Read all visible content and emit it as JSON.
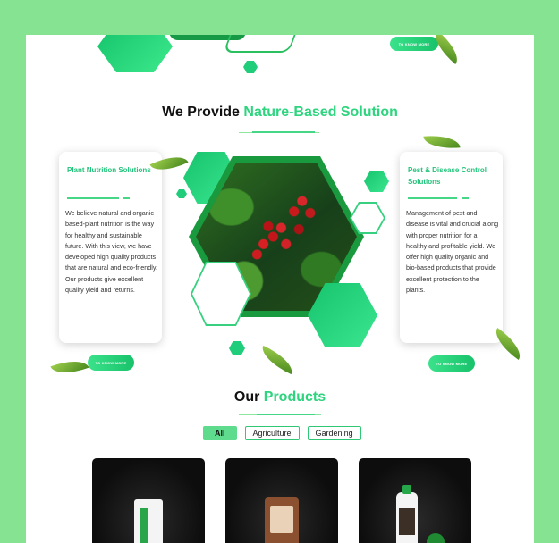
{
  "top": {
    "button_label": "TO KNOW MORE"
  },
  "provide": {
    "title_prefix": "We Provide",
    "title_accent": "Nature-Based Solution"
  },
  "cards": [
    {
      "title": "Plant Nutrition Solutions",
      "body": "We believe natural and organic based-plant nutrition is the way for healthy and sustainable future. With this view, we have developed high quality products that are natural and eco-friendly. Our products give excellent quality yield and returns.",
      "button_label": "TO KNOW MORE"
    },
    {
      "title": "Pest & Disease Control Solutions",
      "body": "Management of pest and disease is vital and crucial along with proper nutrition for a healthy and profitable yield. We offer high quality organic and bio-based products that provide excellent protection to the plants.",
      "button_label": "TO KNOW MORE"
    }
  ],
  "products": {
    "title_prefix": "Our",
    "title_accent": "Products",
    "filters": [
      "All",
      "Agriculture",
      "Gardening"
    ],
    "active_filter": "All"
  },
  "colors": {
    "background": "#86e392",
    "accent": "#2ed47e",
    "brand_green": "#17c26a",
    "product_card": "#0d0d0d"
  },
  "icons": [
    "leaf-icon",
    "hexagon-icon"
  ]
}
